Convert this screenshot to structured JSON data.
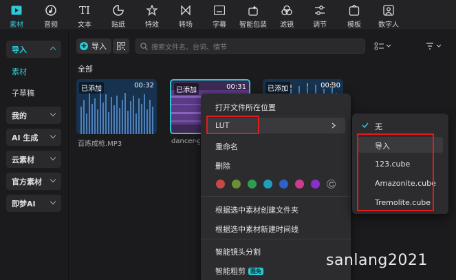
{
  "toolbar": {
    "items": [
      {
        "label": "素材",
        "icon": "media-icon"
      },
      {
        "label": "音频",
        "icon": "audio-icon"
      },
      {
        "label": "文本",
        "icon": "text-icon"
      },
      {
        "label": "贴纸",
        "icon": "sticker-icon"
      },
      {
        "label": "特效",
        "icon": "effects-icon"
      },
      {
        "label": "转场",
        "icon": "transition-icon"
      },
      {
        "label": "字幕",
        "icon": "subtitle-icon"
      },
      {
        "label": "智能包装",
        "icon": "smart-pack-icon"
      },
      {
        "label": "滤镜",
        "icon": "filter-icon"
      },
      {
        "label": "调节",
        "icon": "adjust-icon"
      },
      {
        "label": "模板",
        "icon": "template-icon"
      },
      {
        "label": "数字人",
        "icon": "digital-human-icon"
      }
    ],
    "active_index": 0
  },
  "sidebar": {
    "groups": [
      {
        "label": "导入",
        "expanded": true
      },
      {
        "label": "我的"
      },
      {
        "label": "AI 生成"
      },
      {
        "label": "云素材"
      },
      {
        "label": "官方素材"
      },
      {
        "label": "即梦AI"
      }
    ],
    "sub_items": [
      {
        "label": "素材",
        "active": true
      },
      {
        "label": "子草稿"
      }
    ]
  },
  "main": {
    "import_label": "导入",
    "search_placeholder": "搜索文件名、台词、情节",
    "section_title": "全部",
    "cards": [
      {
        "badge": "已添加",
        "duration": "00:32",
        "name": "百炼成枪.MP3"
      },
      {
        "badge": "已添加",
        "duration": "00:31",
        "name": "dancer-g"
      },
      {
        "badge": "已添加",
        "duration": "00:30",
        "name": ""
      }
    ]
  },
  "context_menu": {
    "open_location": "打开文件所在位置",
    "lut": "LUT",
    "rename": "重命名",
    "delete": "删除",
    "colors": [
      "#c84848",
      "#6a8f34",
      "#2e9e4e",
      "#1f9ebc",
      "#2e62c8",
      "#cc3d8e",
      "#8a2ecc"
    ],
    "create_folder": "根据选中素材创建文件夹",
    "create_timeline": "根据选中素材新建时间线",
    "smart_split": "智能镜头分割",
    "smart_rough_cut": "智能粗剪",
    "free_badge": "限免"
  },
  "lut_submenu": {
    "items": [
      {
        "label": "无",
        "checked": true
      },
      {
        "label": "导入"
      },
      {
        "label": "123.cube"
      },
      {
        "label": "Amazonite.cube"
      },
      {
        "label": "Tremolite.cube"
      }
    ]
  },
  "watermark": "sanlang2021",
  "accent_color": "#2ec8d6",
  "highlight_color": "#e01d1d"
}
